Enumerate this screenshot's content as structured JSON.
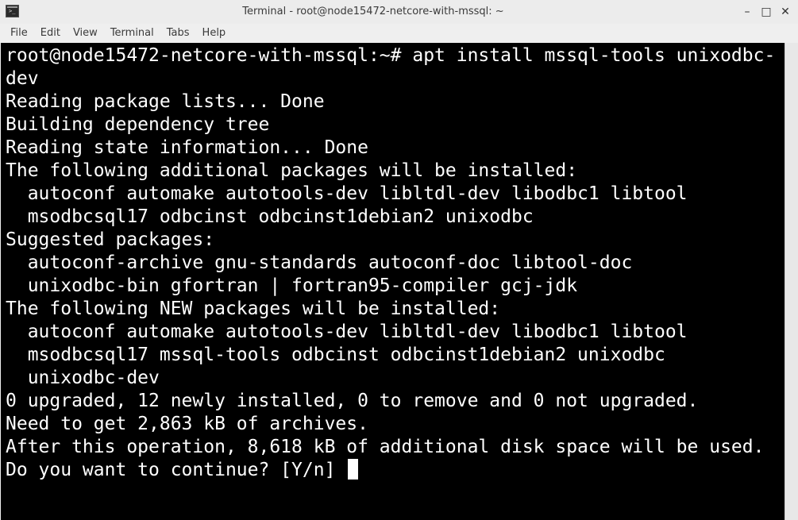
{
  "window": {
    "title": "Terminal - root@node15472-netcore-with-mssql: ~",
    "icon": "terminal-icon",
    "icon_glyph": ">_",
    "controls": {
      "minimize": "–",
      "maximize": "□",
      "close": "✕"
    }
  },
  "menu": {
    "items": [
      "File",
      "Edit",
      "View",
      "Terminal",
      "Tabs",
      "Help"
    ]
  },
  "terminal": {
    "background": "#000000",
    "foreground": "#ffffff",
    "lines": [
      "root@node15472-netcore-with-mssql:~# apt install mssql-tools unixodbc-",
      "dev",
      "Reading package lists... Done",
      "Building dependency tree",
      "Reading state information... Done",
      "The following additional packages will be installed:",
      "  autoconf automake autotools-dev libltdl-dev libodbc1 libtool",
      "  msodbcsql17 odbcinst odbcinst1debian2 unixodbc",
      "Suggested packages:",
      "  autoconf-archive gnu-standards autoconf-doc libtool-doc",
      "  unixodbc-bin gfortran | fortran95-compiler gcj-jdk",
      "The following NEW packages will be installed:",
      "  autoconf automake autotools-dev libltdl-dev libodbc1 libtool",
      "  msodbcsql17 mssql-tools odbcinst odbcinst1debian2 unixodbc",
      "  unixodbc-dev",
      "0 upgraded, 12 newly installed, 0 to remove and 0 not upgraded.",
      "Need to get 2,863 kB of archives.",
      "After this operation, 8,618 kB of additional disk space will be used."
    ],
    "prompt_line": "Do you want to continue? [Y/n] "
  }
}
